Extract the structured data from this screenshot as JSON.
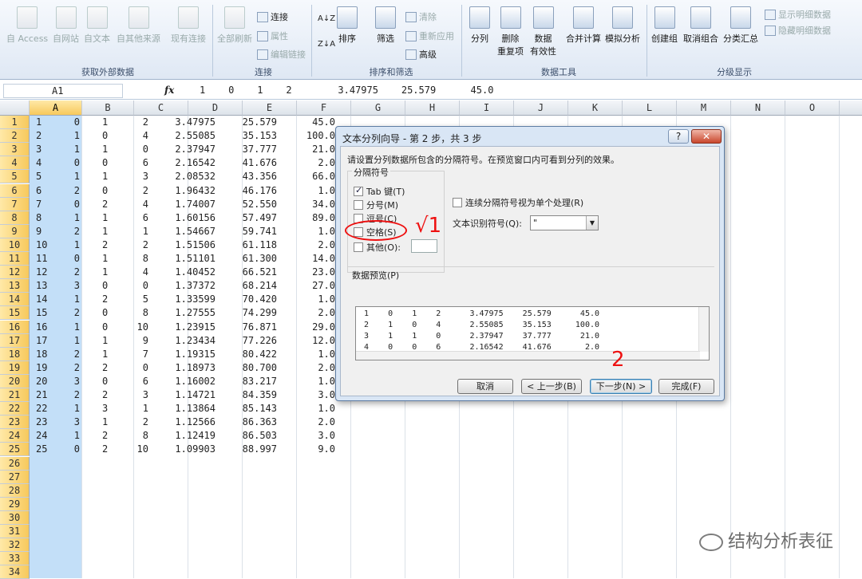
{
  "ribbon": {
    "get_data": {
      "access": "自 Access",
      "web": "自网站",
      "text": "自文本",
      "other": "自其他来源",
      "existing": "现有连接",
      "group": "获取外部数据"
    },
    "connections": {
      "refresh": "全部刷新",
      "conn": "连接",
      "props": "属性",
      "edit": "编辑链接",
      "group": "连接"
    },
    "sort": {
      "sort": "排序",
      "filter": "筛选",
      "clear": "清除",
      "reapply": "重新应用",
      "advanced": "高级",
      "group": "排序和筛选"
    },
    "tools": {
      "split": "分列",
      "remove_dup_1": "删除",
      "remove_dup_2": "重复项",
      "validate_1": "数据",
      "validate_2": "有效性",
      "merge": "合并计算",
      "whatif": "模拟分析",
      "group": "数据工具"
    },
    "outline": {
      "group_btn": "创建组",
      "ungroup": "取消组合",
      "subtotal": "分类汇总",
      "show_detail": "显示明细数据",
      "hide_detail": "隐藏明细数据",
      "group": "分级显示"
    }
  },
  "formula_bar": {
    "cell_ref": "A1",
    "fx": "fx",
    "value": "1    0    1    2        3.47975    25.579      45.0"
  },
  "sheet": {
    "columns": [
      "A",
      "B",
      "C",
      "D",
      "E",
      "F",
      "G",
      "H",
      "I",
      "J",
      "K",
      "L",
      "M",
      "N",
      "O",
      "P"
    ],
    "rows": [
      [
        "1",
        "0",
        "1",
        "2",
        "3.47975",
        "25.579",
        "45.0"
      ],
      [
        "2",
        "1",
        "0",
        "4",
        "2.55085",
        "35.153",
        "100.0"
      ],
      [
        "3",
        "1",
        "1",
        "0",
        "2.37947",
        "37.777",
        "21.0"
      ],
      [
        "4",
        "0",
        "0",
        "6",
        "2.16542",
        "41.676",
        "2.0"
      ],
      [
        "5",
        "1",
        "1",
        "3",
        "2.08532",
        "43.356",
        "66.0"
      ],
      [
        "6",
        "2",
        "0",
        "2",
        "1.96432",
        "46.176",
        "1.0"
      ],
      [
        "7",
        "0",
        "2",
        "4",
        "1.74007",
        "52.550",
        "34.0"
      ],
      [
        "8",
        "1",
        "1",
        "6",
        "1.60156",
        "57.497",
        "89.0"
      ],
      [
        "9",
        "2",
        "1",
        "1",
        "1.54667",
        "59.741",
        "1.0"
      ],
      [
        "10",
        "1",
        "2",
        "2",
        "1.51506",
        "61.118",
        "2.0"
      ],
      [
        "11",
        "0",
        "1",
        "8",
        "1.51101",
        "61.300",
        "14.0"
      ],
      [
        "12",
        "2",
        "1",
        "4",
        "1.40452",
        "66.521",
        "23.0"
      ],
      [
        "13",
        "3",
        "0",
        "0",
        "1.37372",
        "68.214",
        "27.0"
      ],
      [
        "14",
        "1",
        "2",
        "5",
        "1.33599",
        "70.420",
        "1.0"
      ],
      [
        "15",
        "2",
        "0",
        "8",
        "1.27555",
        "74.299",
        "2.0"
      ],
      [
        "16",
        "1",
        "0",
        "10",
        "1.23915",
        "76.871",
        "29.0"
      ],
      [
        "17",
        "1",
        "1",
        "9",
        "1.23434",
        "77.226",
        "12.0"
      ],
      [
        "18",
        "2",
        "1",
        "7",
        "1.19315",
        "80.422",
        "1.0"
      ],
      [
        "19",
        "2",
        "2",
        "0",
        "1.18973",
        "80.700",
        "2.0"
      ],
      [
        "20",
        "3",
        "0",
        "6",
        "1.16002",
        "83.217",
        "1.0"
      ],
      [
        "21",
        "2",
        "2",
        "3",
        "1.14721",
        "84.359",
        "3.0"
      ],
      [
        "22",
        "1",
        "3",
        "1",
        "1.13864",
        "85.143",
        "1.0"
      ],
      [
        "23",
        "3",
        "1",
        "2",
        "1.12566",
        "86.363",
        "2.0"
      ],
      [
        "24",
        "1",
        "2",
        "8",
        "1.12419",
        "86.503",
        "3.0"
      ],
      [
        "25",
        "0",
        "2",
        "10",
        "1.09903",
        "88.997",
        "9.0"
      ]
    ],
    "row_count": 34
  },
  "dialog": {
    "title": "文本分列向导 - 第 2 步，共 3 步",
    "help": "?",
    "close": "✕",
    "instruction": "请设置分列数据所包含的分隔符号。在预览窗口内可看到分列的效果。",
    "sep_legend": "分隔符号",
    "tab": "Tab 键(T)",
    "semicolon": "分号(M)",
    "comma": "逗号(C)",
    "space": "空格(S)",
    "other": "其他(O):",
    "consecutive": "连续分隔符号视为单个处理(R)",
    "qualifier_label": "文本识别符号(Q):",
    "qualifier_value": "\"",
    "preview_label": "数据预览(P)",
    "preview_rows": [
      "1    0    1    2      3.47975    25.579      45.0",
      "2    1    0    4      2.55085    35.153     100.0",
      "3    1    1    0      2.37947    37.777      21.0",
      "4    0    0    6      2.16542    41.676       2.0"
    ],
    "cancel": "取消",
    "back": "< 上一步(B)",
    "next": "下一步(N) >",
    "finish": "完成(F)"
  },
  "annotations": {
    "check": "√1",
    "step2": "2"
  },
  "watermark": "结构分析表征"
}
